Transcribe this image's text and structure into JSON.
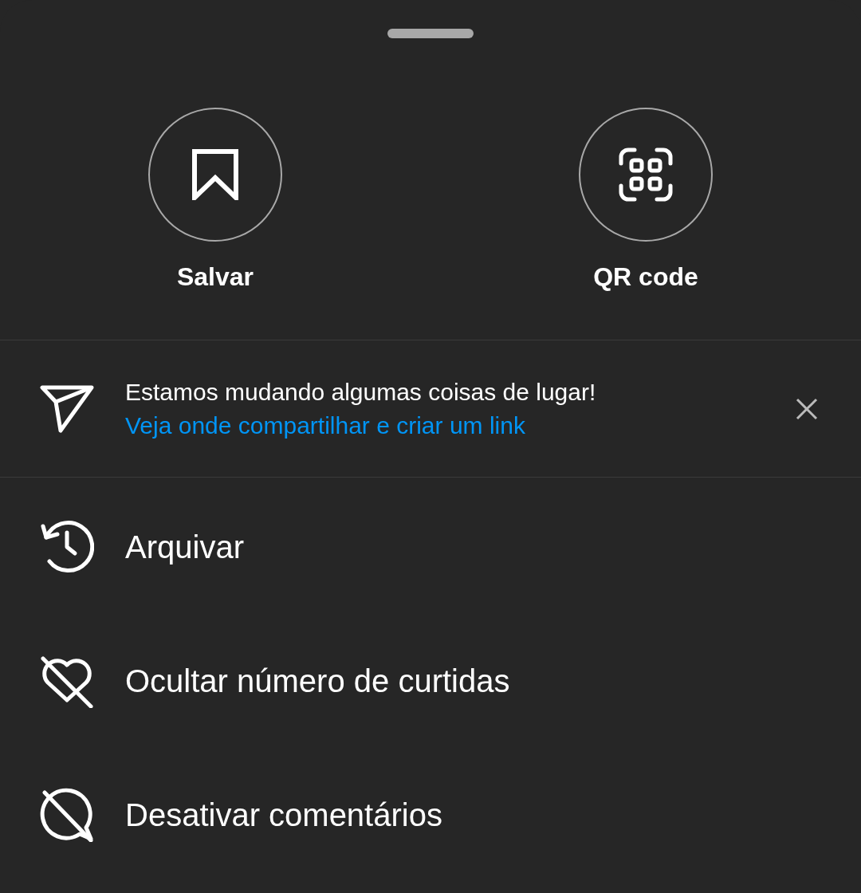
{
  "actions": [
    {
      "label": "Salvar",
      "kind": "bookmark"
    },
    {
      "label": "QR code",
      "kind": "qr"
    }
  ],
  "notice": {
    "message": "Estamos mudando algumas coisas de lugar!",
    "link": "Veja onde compartilhar e criar um link"
  },
  "menu": [
    {
      "label": "Arquivar",
      "kind": "archive"
    },
    {
      "label": "Ocultar número de curtidas",
      "kind": "hide-likes"
    },
    {
      "label": "Desativar comentários",
      "kind": "no-comments"
    }
  ]
}
